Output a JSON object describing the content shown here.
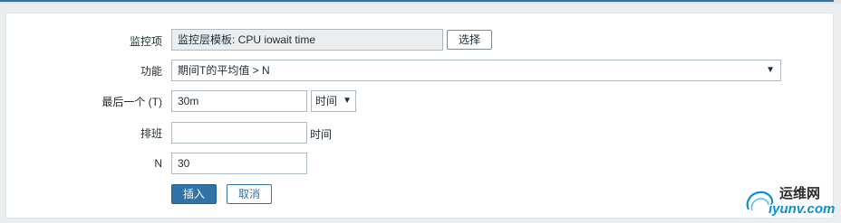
{
  "form": {
    "item": {
      "label": "监控项",
      "value": "监控层模板: CPU iowait time",
      "select_button": "选择"
    },
    "function": {
      "label": "功能",
      "value": "期间T的平均值 > N",
      "arrow": "▼"
    },
    "last": {
      "label": "最后一个 (T)",
      "value": "30m",
      "unit_value": "时间",
      "arrow": "▼"
    },
    "shift": {
      "label": "排班",
      "value": "",
      "suffix": "时间"
    },
    "n": {
      "label": "N",
      "value": "30"
    },
    "buttons": {
      "insert": "插入",
      "cancel": "取消"
    }
  },
  "watermark": {
    "line1": "运维网",
    "line2": "iyunv.com"
  },
  "colors": {
    "accent": "#2f73a8",
    "border": "#acbbc2",
    "readonly_bg": "#ebeef0",
    "watermark_blue": "#0a8fd4"
  }
}
